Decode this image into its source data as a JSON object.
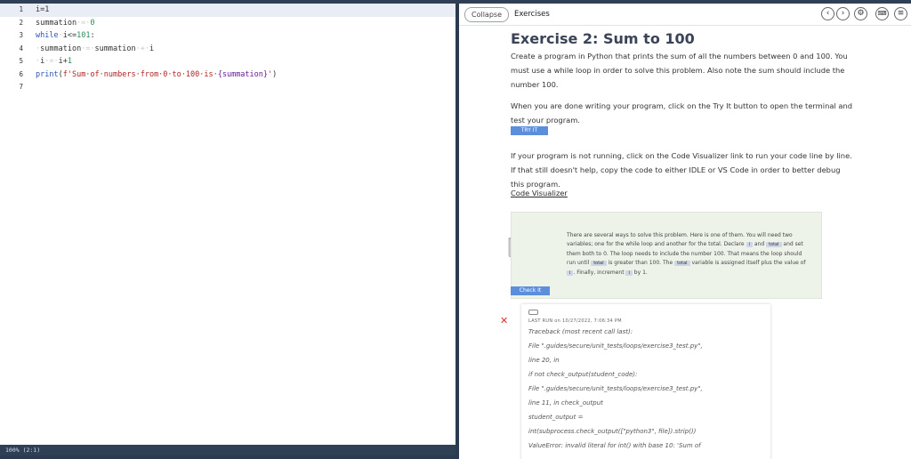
{
  "editor": {
    "lines": [
      {
        "num": "1",
        "parts": [
          {
            "t": "i=1",
            "c": ""
          }
        ]
      },
      {
        "num": "2",
        "parts": [
          {
            "t": "summation",
            "c": ""
          },
          {
            "t": "·=·",
            "c": "tok-ws"
          },
          {
            "t": "0",
            "c": "tok-num"
          }
        ]
      },
      {
        "num": "3",
        "parts": [
          {
            "t": "while",
            "c": "tok-kw"
          },
          {
            "t": "·",
            "c": "tok-ws"
          },
          {
            "t": "i<=",
            "c": ""
          },
          {
            "t": "101",
            "c": "tok-num"
          },
          {
            "t": ":",
            "c": ""
          }
        ]
      },
      {
        "num": "4",
        "parts": [
          {
            "t": "·",
            "c": "tok-ws"
          },
          {
            "t": "summation",
            "c": ""
          },
          {
            "t": "·=·",
            "c": "tok-ws"
          },
          {
            "t": "summation",
            "c": ""
          },
          {
            "t": "·+·",
            "c": "tok-ws"
          },
          {
            "t": "i",
            "c": ""
          }
        ]
      },
      {
        "num": "5",
        "parts": [
          {
            "t": "·",
            "c": "tok-ws"
          },
          {
            "t": "i",
            "c": ""
          },
          {
            "t": "·=·",
            "c": "tok-ws"
          },
          {
            "t": "i+",
            "c": ""
          },
          {
            "t": "1",
            "c": "tok-num"
          }
        ]
      },
      {
        "num": "6",
        "parts": [
          {
            "t": "print",
            "c": "tok-kw"
          },
          {
            "t": "(",
            "c": ""
          },
          {
            "t": "f'Sum·of·numbers·from·0·to·100·is·",
            "c": "tok-str"
          },
          {
            "t": "{summation}",
            "c": "tok-var"
          },
          {
            "t": "'",
            "c": "tok-str"
          },
          {
            "t": ")",
            "c": ""
          }
        ]
      },
      {
        "num": "7",
        "parts": []
      }
    ],
    "status": "100% (2:1)"
  },
  "header": {
    "collapse_label": "Collapse",
    "tab_label": "Exercises",
    "icons": [
      "chevron-left-icon",
      "chevron-right-icon",
      "gear-icon",
      "keyboard-icon",
      "menu-icon"
    ]
  },
  "exercise": {
    "title": "Exercise 2: Sum to 100",
    "para1": "Create a program in Python that prints the sum of all the numbers between 0 and 100. You must use a while loop in order to solve this problem. Also note the sum should include the number 100.",
    "para2": "When you are done writing your program, click on the Try It button to open the terminal and test your program.",
    "try_label": "TRY IT",
    "para3": "If your program is not running, click on the Code Visualizer link to run your code line by line. If that still doesn't help, copy the code to either IDLE or VS Code in order to better debug this program.",
    "visualizer_label": "Code Visualizer",
    "hint": {
      "t1": "There are several ways to solve this problem. Here is one of them. You will need two variables; one for the while loop and another for the total. Declare",
      "c1": "i",
      "t2": "and",
      "c2": "total",
      "t3": "and set them both to 0. The loop needs to include the number 100. That means the loop should run until",
      "c3": "total",
      "t4": "is greater than 100. The",
      "c4": "total",
      "t5": "variable is assigned itself plus the value of",
      "c5": "i",
      "t6": ". Finally, increment",
      "c6": "i",
      "t7": "by 1."
    },
    "check_label": "Check It",
    "result": {
      "last_run": "LAST RUN on 10/27/2022, 7:06:34 PM",
      "traceback": [
        "Traceback (most recent call last):",
        "  File \".guides/secure/unit_tests/loops/exercise3_test.py\",",
        "line 20, in",
        "      if not check_output(student_code):",
        "  File \".guides/secure/unit_tests/loops/exercise3_test.py\",",
        "line 11, in check_output",
        "      student_output =",
        "int(subprocess.check_output([\"python3\", file]).strip())",
        "ValueError: invalid literal for int() with base 10: 'Sum of"
      ]
    }
  }
}
